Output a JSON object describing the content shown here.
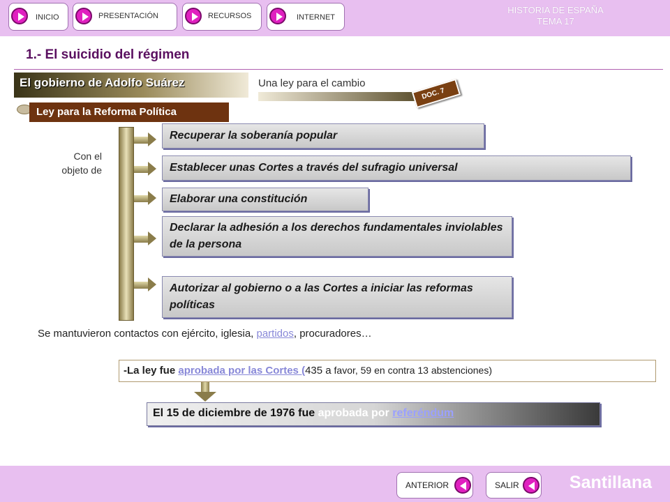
{
  "nav": {
    "inicio": "INICIO",
    "presentacion": "PRESENTACIÓN",
    "recursos": "RECURSOS",
    "internet": "INTERNET"
  },
  "header": {
    "line1": "HISTORIA DE ESPAÑA",
    "line2": "TEMA 17"
  },
  "page_title": "1.- El suicidio del régimen",
  "section": {
    "title": "El gobierno de Adolfo Suárez",
    "subtitle": "Una ley para el cambio",
    "doc_tag": "DOC. 7"
  },
  "law_label": "Ley para la Reforma Política",
  "objective_label": {
    "line1": "Con el",
    "line2": "objeto de"
  },
  "objectives": [
    "Recuperar la soberanía popular",
    "Establecer unas Cortes a través del sufragio universal",
    "Elaborar una constitución",
    "Declarar la adhesión a los derechos fundamentales inviolables de la persona",
    "Autorizar al gobierno o a las Cortes a iniciar las reformas políticas"
  ],
  "contacts": {
    "prefix": "Se mantuvieron contactos con ejército, iglesia, ",
    "link": "partidos",
    "suffix": ", procuradores…"
  },
  "approval": {
    "prefix": "-La ley fue ",
    "link": "aprobada por las Cortes  (",
    "votes_big": "435 a",
    "votes_small": " favor, 59 en contra 13 abstenciones)"
  },
  "result": {
    "prefix": "El 15 de diciembre de 1976 fue ",
    "emph": "aprobada por ",
    "link": "referéndum"
  },
  "footer": {
    "anterior": "ANTERIOR",
    "salir": "SALIR",
    "brand": "Santillana"
  },
  "colors": {
    "band": "#e8bff0",
    "accent": "#e020c0",
    "title": "#5a1060",
    "law_label_bg": "#6e3310",
    "link": "#8888d8"
  }
}
